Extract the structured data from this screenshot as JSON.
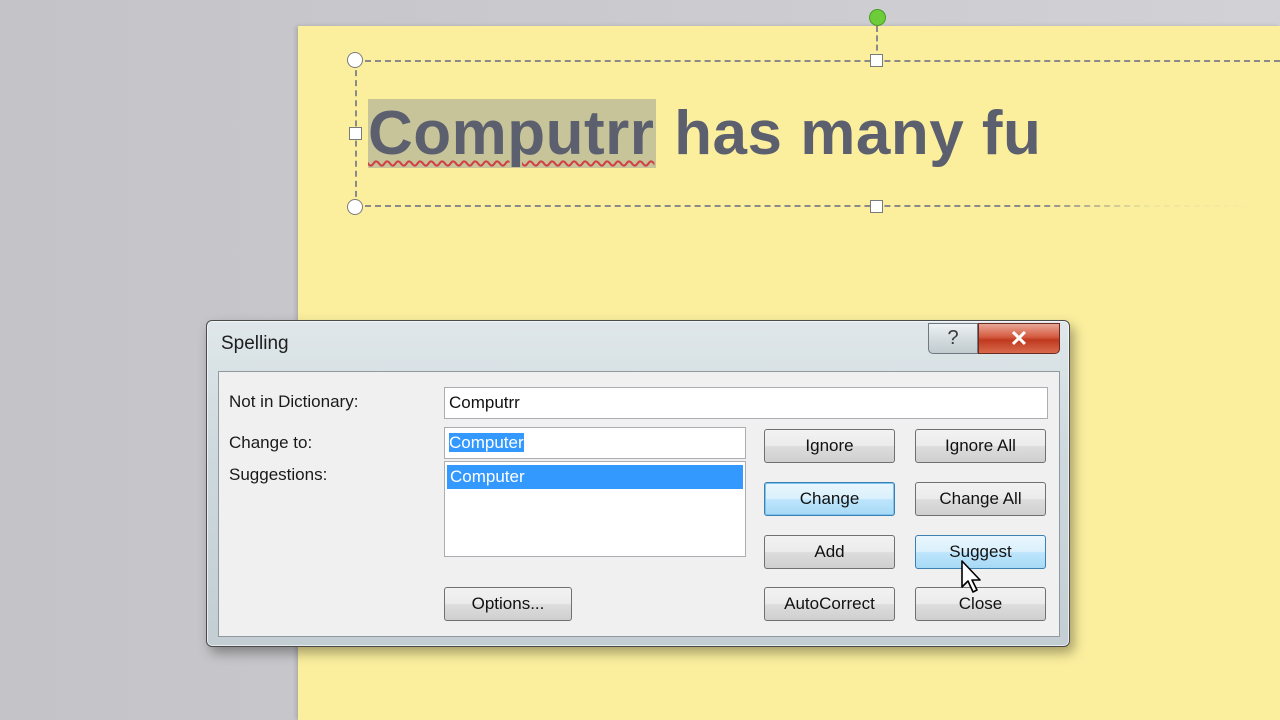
{
  "slide": {
    "title_misspelled": "Computrr",
    "title_rest": " has many fu"
  },
  "dialog": {
    "title": "Spelling",
    "help_glyph": "?",
    "close_glyph": "✕",
    "not_in_dictionary_label": "Not in Dictionary:",
    "not_in_dictionary_value": "Computrr",
    "change_to_label": "Change to:",
    "change_to_value": "Computer",
    "suggestions_label": "Suggestions:",
    "suggestions": [
      "Computer"
    ],
    "buttons": {
      "ignore": "Ignore",
      "ignore_all": "Ignore All",
      "change": "Change",
      "change_all": "Change All",
      "add": "Add",
      "suggest": "Suggest",
      "options": "Options...",
      "autocorrect": "AutoCorrect",
      "close": "Close"
    }
  },
  "colors": {
    "slide_background": "#fbef9e",
    "selection": "#3399ff",
    "rotate_handle": "#6dcc3a",
    "close_button": "#c0391f"
  },
  "icons": [
    "help-icon",
    "close-icon",
    "mouse-pointer-icon"
  ]
}
